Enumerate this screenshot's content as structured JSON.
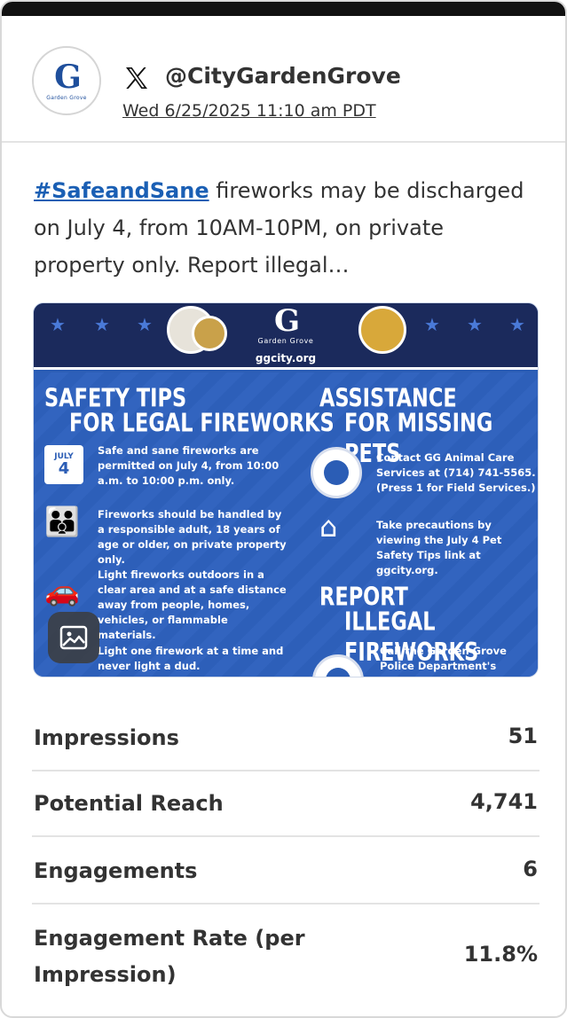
{
  "account": {
    "platform_icon": "x-logo-icon",
    "handle": "@CityGardenGrove",
    "timestamp": "Wed 6/25/2025 11:10 am PDT",
    "avatar_letters": "G",
    "avatar_caption": "Garden Grove"
  },
  "post": {
    "hashtag": "#SafeandSane",
    "text": " fireworks may be discharged on July 4, from 10AM-10PM, on private property only. Report illegal…"
  },
  "media": {
    "logo_letters": "G",
    "logo_caption": "Garden Grove",
    "url": "ggcity.org",
    "safety_title_1": "SAFETY TIPS",
    "safety_title_2": "FOR LEGAL FIREWORKS",
    "calendar_month": "JULY",
    "calendar_day": "4",
    "tips": [
      "Safe and sane fireworks are permitted on July 4, from 10:00 a.m. to 10:00 p.m. only.",
      "Fireworks should be handled by a responsible adult, 18 years of age or older, on private property only.",
      "Light fireworks outdoors in a clear area and at a safe distance away from people, homes, vehicles, or flammable materials.",
      "Light one firework at a time and never light a dud."
    ],
    "pets_title_1": "ASSISTANCE",
    "pets_title_2": "FOR MISSING PETS",
    "pets_tips": [
      "Contact GG Animal Care Services at (714) 741-5565. (Press 1 for Field Services.)",
      "Take precautions by viewing the July 4 Pet Safety Tips link at ggcity.org."
    ],
    "report_title_1": "REPORT",
    "report_title_2": "ILLEGAL FIREWORKS",
    "report_text": "Call the Garden Grove Police Department's"
  },
  "stats": [
    {
      "label": "Impressions",
      "value": "51"
    },
    {
      "label": "Potential Reach",
      "value": "4,741"
    },
    {
      "label": "Engagements",
      "value": "6"
    },
    {
      "label": "Engagement Rate (per Impression)",
      "value": "11.8%"
    }
  ],
  "colors": {
    "hashtag": "#1a5fb4",
    "flyer_blue": "#2d5fb9",
    "flyer_navy": "#1b2a5c",
    "top_bar": "#111111"
  }
}
